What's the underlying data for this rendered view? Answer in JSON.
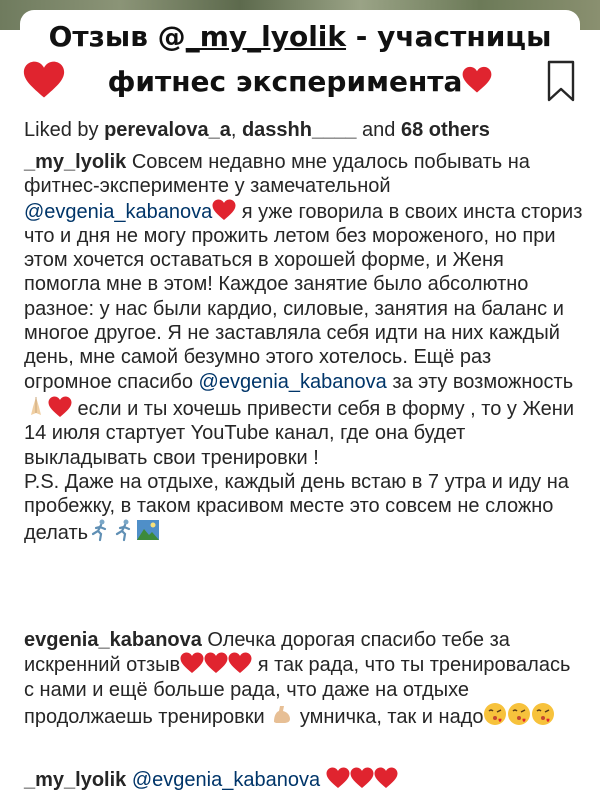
{
  "title": {
    "line1_prefix": "Отзыв @",
    "line1_handle": "_my_lyolik",
    "line1_suffix": " - участницы",
    "line2": "фитнес эксперимента"
  },
  "likes": {
    "prefix": "Liked by ",
    "user1": "perevalova_a",
    "sep": ", ",
    "user2": "dasshh____",
    "mid": " and ",
    "others": "68 others"
  },
  "comments": [
    {
      "author": "_my_lyolik",
      "t1": " Совсем недавно мне удалось побывать на фитнес-эксперименте у замечательной ",
      "m1": "@evgenia_kabanova",
      "t2": " я уже говорила в своих инста сториз что и дня не могу прожить летом без мороженого, но при  этом хочется оставаться в хорошей форме, и Женя помогла мне в этом! Каждое занятие было абсолютно разное: у нас были кардио, силовые, занятия на баланс и многое другое. Я не заставляла себя идти на них каждый день, мне самой безумно этого хотелось. Ещё раз огромное спасибо ",
      "m2": "@evgenia_kabanova",
      "t3": " за эту возможность",
      "t4": " если и ты хочешь привести себя в форму , то у Жени 14 июля стартует YouTube канал, где она будет выкладывать свои тренировки !",
      "t5": "P.S. Даже на отдыхе, каждый день встаю в 7 утра и иду на пробежку, в таком красивом месте это совсем не сложно делать"
    },
    {
      "author": "evgenia_kabanova",
      "t1": " Олечка дорогая спасибо тебе за искренний отзыв",
      "t2": " я так рада, что ты тренировалась с нами и ещё больше рада, что даже на отдыхе продолжаешь тренировки ",
      "t3": " умничка, так и надо"
    },
    {
      "author": "_my_lyolik",
      "m1": "@evgenia_kabanova"
    }
  ],
  "icons": {
    "like": "heart-icon",
    "bookmark": "bookmark-icon",
    "heart_color": "#e0242f",
    "mention_color": "#003569"
  }
}
